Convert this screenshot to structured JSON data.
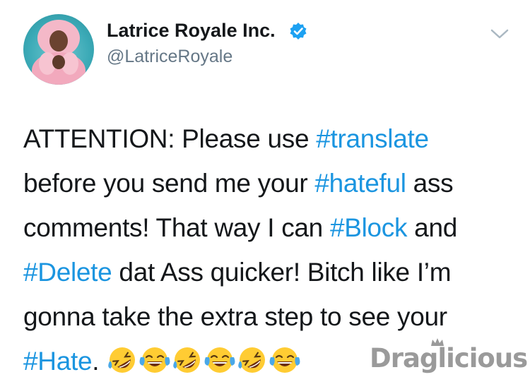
{
  "tweet": {
    "display_name": "Latrice Royale Inc.",
    "handle": "@LatriceRoyale",
    "verified": true,
    "lines": [
      [
        {
          "t": "ATTENTION: Please use ",
          "h": false
        },
        {
          "t": "#translate",
          "h": true
        }
      ],
      [
        {
          "t": "before you send me your ",
          "h": false
        },
        {
          "t": "#hateful",
          "h": true
        },
        {
          "t": " ass",
          "h": false
        }
      ],
      [
        {
          "t": "comments! That way I can ",
          "h": false
        },
        {
          "t": "#Block",
          "h": true
        },
        {
          "t": " and",
          "h": false
        }
      ],
      [
        {
          "t": "#Delete",
          "h": true
        },
        {
          "t": " dat Ass quicker! Bitch like I’m",
          "h": false
        }
      ],
      [
        {
          "t": "gonna take the extra step to see your",
          "h": false
        }
      ],
      [
        {
          "t": "#Hate",
          "h": true
        },
        {
          "t": ".",
          "h": false
        }
      ]
    ],
    "emojis": [
      "rolling-on-floor-laughing",
      "tears-of-joy",
      "rolling-on-floor-laughing",
      "tears-of-joy",
      "rolling-on-floor-laughing",
      "tears-of-joy"
    ],
    "hashtag_color": "#1b95e0",
    "verified_color": "#1da1f2"
  },
  "watermark": {
    "text": "Draglicious"
  }
}
